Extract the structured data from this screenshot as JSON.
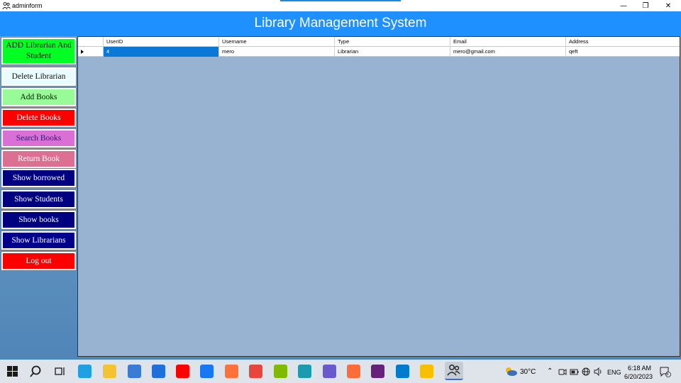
{
  "window": {
    "title": "adminform",
    "minimize": "—",
    "restore": "❐",
    "close": "✕"
  },
  "header": {
    "title": "Library Management System"
  },
  "sidebar": {
    "buttons": [
      {
        "label": "ADD Librarian And Student",
        "bg": "#00ff22",
        "fg": "#111111"
      },
      {
        "label": "Delete Librarian",
        "bg": "#e9fbff",
        "fg": "#111111"
      },
      {
        "label": "Add Books",
        "bg": "#98fb98",
        "fg": "#111111"
      },
      {
        "label": "Delete Books",
        "bg": "#ff0000",
        "fg": "#ffffff"
      },
      {
        "label": "Search Books",
        "bg": "#da70d6",
        "fg": "#1f1f7a"
      },
      {
        "label": "Return Book",
        "bg": "#db7093",
        "fg": "#ffffff"
      },
      {
        "label": "Show borrowed",
        "bg": "#000080",
        "fg": "#ffffff"
      },
      {
        "label": "Show Students",
        "bg": "#000080",
        "fg": "#ffffff"
      },
      {
        "label": "Show books",
        "bg": "#000080",
        "fg": "#ffffff"
      },
      {
        "label": "Show Librarians",
        "bg": "#00008b",
        "fg": "#ffffff"
      },
      {
        "label": "Log out",
        "bg": "#ff0000",
        "fg": "#ffffff"
      }
    ]
  },
  "grid": {
    "columns": [
      "UserID",
      "Username",
      "Type",
      "Email",
      "Address"
    ],
    "rows": [
      [
        "4",
        "mero",
        "Librarian",
        "mero@gmail.com",
        "qeft"
      ]
    ]
  },
  "taskbar": {
    "apps": [
      {
        "name": "start-icon",
        "color": "#1a1a1a"
      },
      {
        "name": "search-icon",
        "color": "#1a1a1a"
      },
      {
        "name": "task-view-icon",
        "color": "#1a1a1a"
      },
      {
        "name": "edge-icon",
        "color": "#1fa0e3"
      },
      {
        "name": "file-explorer-icon",
        "color": "#f4c430"
      },
      {
        "name": "store-icon",
        "color": "#3a7bd5"
      },
      {
        "name": "mail-icon",
        "color": "#1e6fd9"
      },
      {
        "name": "youtube-icon",
        "color": "#ff0000"
      },
      {
        "name": "facebook-icon",
        "color": "#1877f2"
      },
      {
        "name": "firefox-icon",
        "color": "#ff7139"
      },
      {
        "name": "chrome-icon",
        "color": "#e8453c"
      },
      {
        "name": "winforms-icon",
        "color": "#7fba00"
      },
      {
        "name": "azure-data-studio-icon",
        "color": "#1a9bb0"
      },
      {
        "name": "tool-purple-icon",
        "color": "#6a5acd"
      },
      {
        "name": "postman-icon",
        "color": "#ff6c37"
      },
      {
        "name": "visual-studio-icon",
        "color": "#68217a"
      },
      {
        "name": "vscode-icon",
        "color": "#007acc"
      },
      {
        "name": "python-tool-icon",
        "color": "#f6c000"
      },
      {
        "name": "adminform-app-icon",
        "color": "#3c3c3c"
      }
    ],
    "weather": "30°C",
    "language": "ENG",
    "time": "6:18 AM",
    "date": "6/20/2023",
    "notifications": "5"
  }
}
